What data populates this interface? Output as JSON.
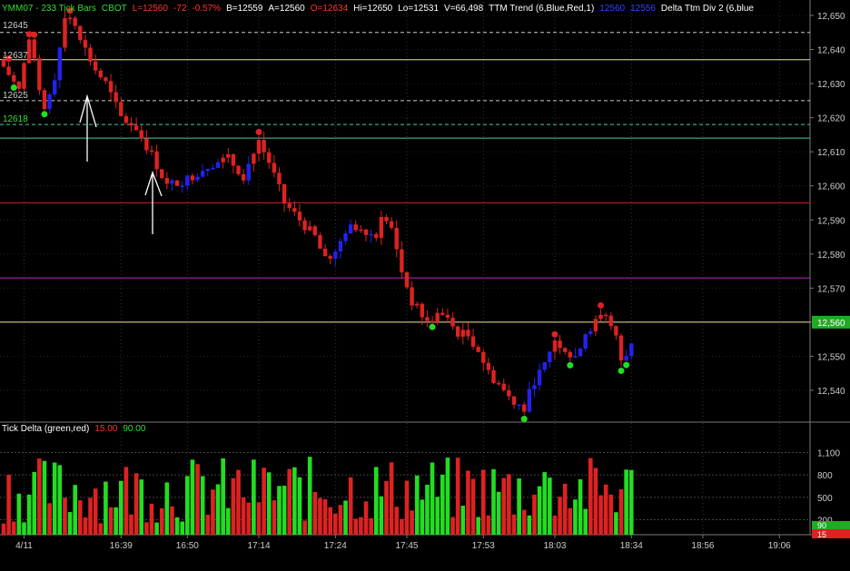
{
  "header": {
    "symbol": "YMM07 - 233 Tick Bars",
    "exchange": "CBOT",
    "last": "L=12560",
    "change": "-72",
    "change_pct": "-0.57%",
    "bid": "B=12559",
    "ask": "A=12560",
    "open": "O=12634",
    "high": "Hi=12650",
    "low": "Lo=12531",
    "volume": "V=66,498",
    "study1": "TTM Trend (6,Blue,Red,1)",
    "study1_v1": "12560",
    "study1_v2": "12556",
    "study2": "Delta Ttm Div 2 (6,blue"
  },
  "subpanel": {
    "title": "Tick Delta (green,red)",
    "val1": "15.00",
    "val2": "90.00"
  },
  "level_labels": [
    "12645",
    "12637",
    "12625",
    "12618"
  ],
  "colors": {
    "up": "#22dd22",
    "down": "#dd2222",
    "trend_blue": "#2222ee",
    "yellow_line": "#e8e8a0",
    "red_line": "#bb2222",
    "magenta_line": "#cc22cc",
    "green_line": "#44ccaa"
  },
  "chart_data": {
    "type": "candlestick",
    "symbol": "YMM07",
    "ylim": [
      12530,
      12652
    ],
    "y_ticks": [
      "12,650",
      "12,640",
      "12,630",
      "12,620",
      "12,610",
      "12,600",
      "12,590",
      "12,580",
      "12,570",
      "12,560",
      "12,550",
      "12,540"
    ],
    "y_tick_values": [
      12650,
      12640,
      12630,
      12620,
      12610,
      12600,
      12590,
      12580,
      12570,
      12560,
      12550,
      12540
    ],
    "last_price_label": "12,560",
    "x_ticks": [
      "4/11",
      "16:39",
      "16:50",
      "17:14",
      "17:24",
      "17:45",
      "17:53",
      "18:03",
      "18:34",
      "18:56",
      "19:06"
    ],
    "x_tick_bar_index": [
      4,
      23,
      36,
      50,
      65,
      79,
      94,
      108,
      123,
      137,
      152
    ],
    "bars_visible": 124,
    "levels": [
      {
        "value": 12645,
        "style": "dashed",
        "color": "white"
      },
      {
        "value": 12637,
        "style": "solid",
        "color": "yellow"
      },
      {
        "value": 12625,
        "style": "dashed",
        "color": "white"
      },
      {
        "value": 12618,
        "style": "dashed",
        "color": "green"
      },
      {
        "value": 12614,
        "style": "solid",
        "color": "green"
      },
      {
        "value": 12595,
        "style": "solid",
        "color": "red"
      },
      {
        "value": 12573,
        "style": "solid",
        "color": "magenta"
      },
      {
        "value": 12560,
        "style": "solid",
        "color": "yellow"
      }
    ],
    "path": [
      [
        0,
        12635
      ],
      [
        3,
        12628
      ],
      [
        5,
        12643
      ],
      [
        8,
        12622
      ],
      [
        10,
        12632
      ],
      [
        12,
        12650
      ],
      [
        14,
        12648
      ],
      [
        16,
        12640
      ],
      [
        18,
        12634
      ],
      [
        20,
        12630
      ],
      [
        23,
        12620
      ],
      [
        26,
        12617
      ],
      [
        29,
        12609
      ],
      [
        32,
        12600
      ],
      [
        36,
        12602
      ],
      [
        40,
        12606
      ],
      [
        44,
        12608
      ],
      [
        47,
        12603
      ],
      [
        50,
        12613
      ],
      [
        52,
        12607
      ],
      [
        55,
        12595
      ],
      [
        58,
        12590
      ],
      [
        61,
        12585
      ],
      [
        63,
        12578
      ],
      [
        65,
        12580
      ],
      [
        67,
        12587
      ],
      [
        69,
        12588
      ],
      [
        71,
        12587
      ],
      [
        73,
        12585
      ],
      [
        74,
        12592
      ],
      [
        76,
        12587
      ],
      [
        78,
        12575
      ],
      [
        80,
        12566
      ],
      [
        83,
        12560
      ],
      [
        86,
        12562
      ],
      [
        89,
        12557
      ],
      [
        91,
        12556
      ],
      [
        93,
        12552
      ],
      [
        95,
        12545
      ],
      [
        97,
        12542
      ],
      [
        99,
        12538
      ],
      [
        102,
        12535
      ],
      [
        104,
        12543
      ],
      [
        106,
        12547
      ],
      [
        108,
        12555
      ],
      [
        110,
        12552
      ],
      [
        112,
        12550
      ],
      [
        114,
        12557
      ],
      [
        116,
        12560
      ],
      [
        118,
        12562
      ],
      [
        120,
        12555
      ],
      [
        121,
        12549
      ],
      [
        123,
        12553
      ],
      [
        125,
        12559
      ],
      [
        127,
        12562
      ]
    ],
    "delta_subpanel": {
      "title": "Tick Delta (green,red)",
      "ylim": [
        0,
        1300
      ],
      "y_ticks": [
        "1,100",
        "800",
        "500",
        "200"
      ],
      "y_tick_values": [
        1100,
        800,
        500,
        200
      ],
      "current_labels": [
        "90",
        "15"
      ]
    }
  }
}
